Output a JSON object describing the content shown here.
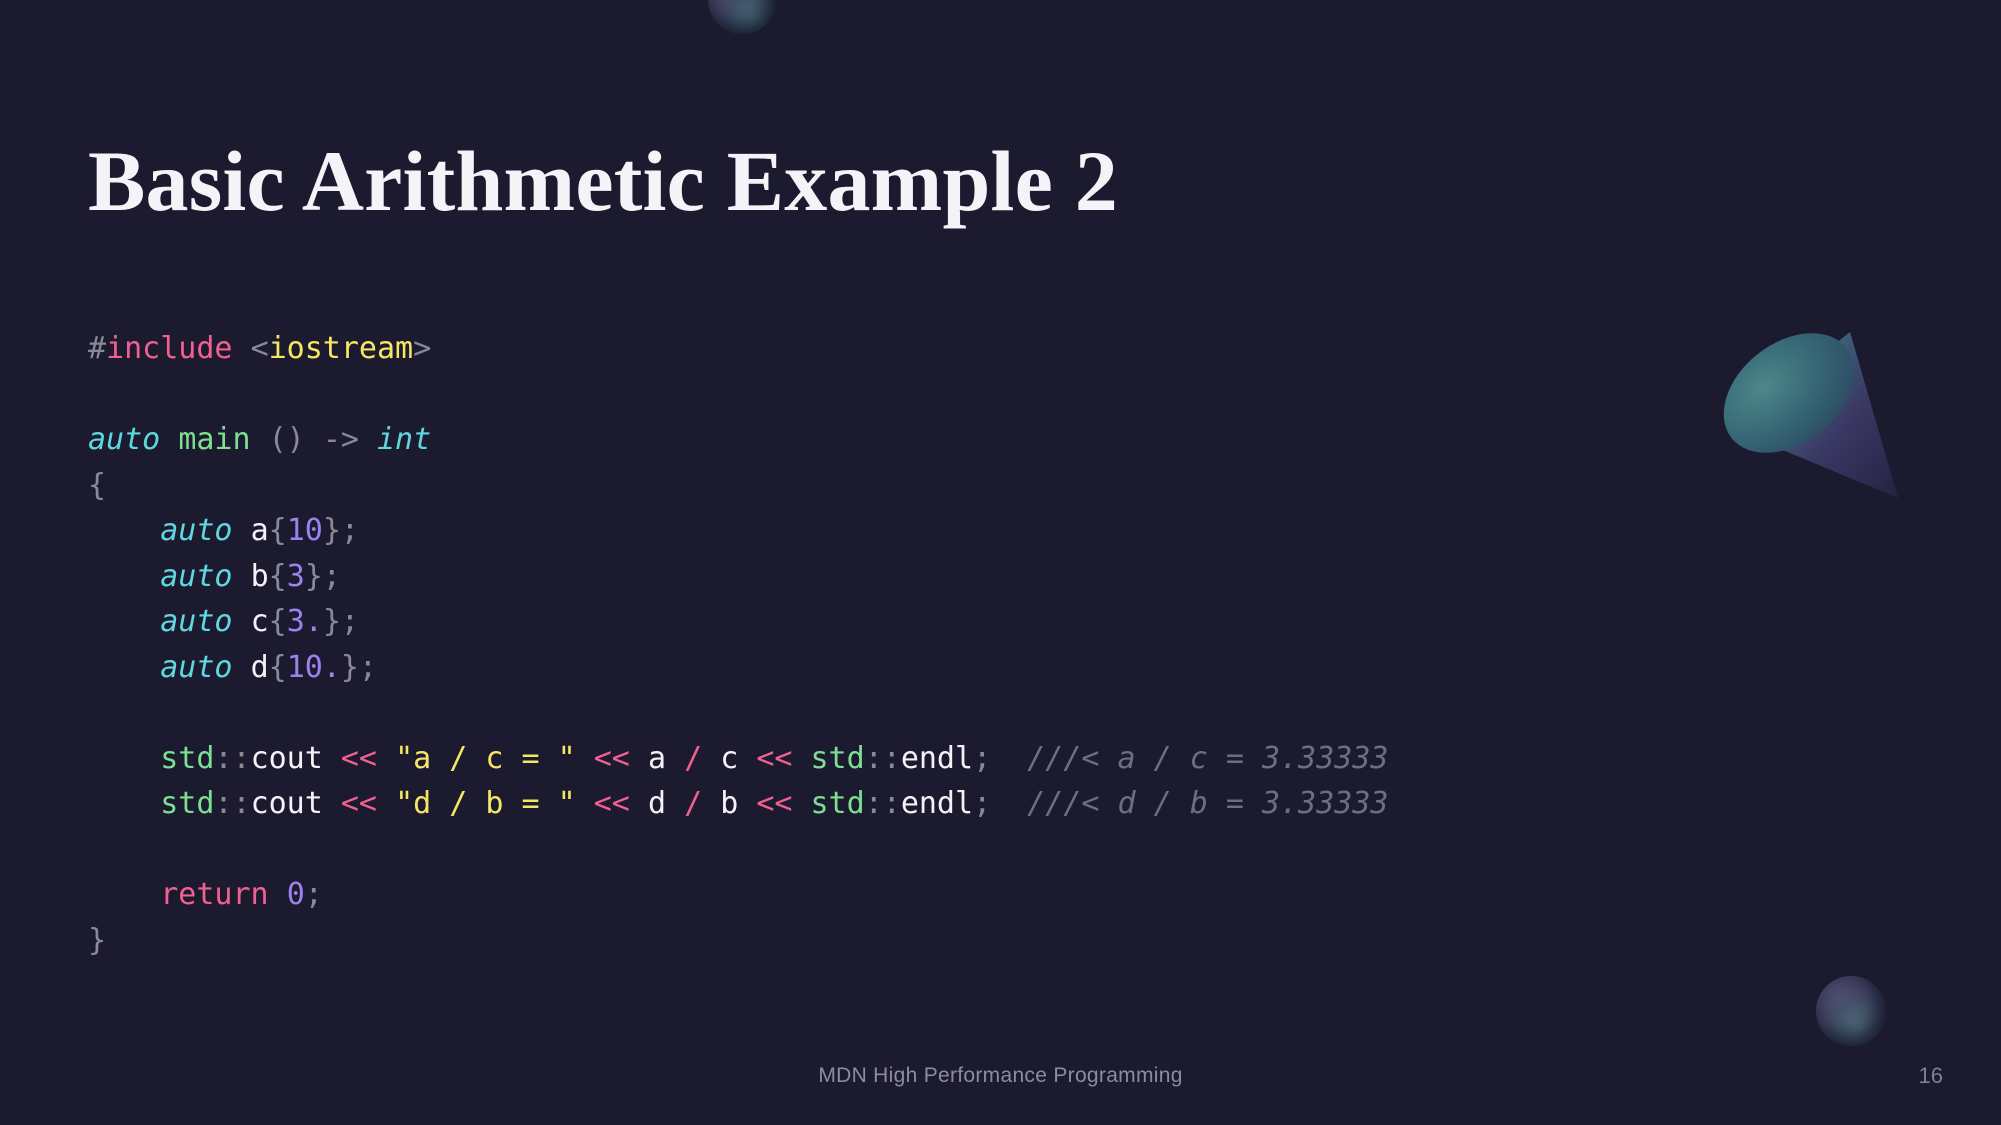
{
  "slide": {
    "title": "Basic Arithmetic Example 2",
    "background_color": "#1c1a2e",
    "footer_text": "MDN High Performance Programming",
    "page_number": "16"
  },
  "code": {
    "language": "cpp",
    "lines": [
      {
        "tokens": [
          {
            "t": "#",
            "c": "punct"
          },
          {
            "t": "include",
            "c": "pre"
          },
          {
            "t": " ",
            "c": "plain"
          },
          {
            "t": "<",
            "c": "punct"
          },
          {
            "t": "iostream",
            "c": "string"
          },
          {
            "t": ">",
            "c": "punct"
          }
        ]
      },
      {
        "tokens": []
      },
      {
        "tokens": [
          {
            "t": "auto",
            "c": "kw"
          },
          {
            "t": " ",
            "c": "plain"
          },
          {
            "t": "main",
            "c": "fn"
          },
          {
            "t": " ",
            "c": "plain"
          },
          {
            "t": "()",
            "c": "punct"
          },
          {
            "t": " ",
            "c": "plain"
          },
          {
            "t": "->",
            "c": "punct"
          },
          {
            "t": " ",
            "c": "plain"
          },
          {
            "t": "int",
            "c": "kw"
          }
        ]
      },
      {
        "tokens": [
          {
            "t": "{",
            "c": "punct"
          }
        ]
      },
      {
        "tokens": [
          {
            "t": "    ",
            "c": "plain"
          },
          {
            "t": "auto",
            "c": "kw"
          },
          {
            "t": " ",
            "c": "plain"
          },
          {
            "t": "a",
            "c": "var"
          },
          {
            "t": "{",
            "c": "punct"
          },
          {
            "t": "10",
            "c": "num"
          },
          {
            "t": "};",
            "c": "punct"
          }
        ]
      },
      {
        "tokens": [
          {
            "t": "    ",
            "c": "plain"
          },
          {
            "t": "auto",
            "c": "kw"
          },
          {
            "t": " ",
            "c": "plain"
          },
          {
            "t": "b",
            "c": "var"
          },
          {
            "t": "{",
            "c": "punct"
          },
          {
            "t": "3",
            "c": "num"
          },
          {
            "t": "};",
            "c": "punct"
          }
        ]
      },
      {
        "tokens": [
          {
            "t": "    ",
            "c": "plain"
          },
          {
            "t": "auto",
            "c": "kw"
          },
          {
            "t": " ",
            "c": "plain"
          },
          {
            "t": "c",
            "c": "var"
          },
          {
            "t": "{",
            "c": "punct"
          },
          {
            "t": "3.",
            "c": "num"
          },
          {
            "t": "};",
            "c": "punct"
          }
        ]
      },
      {
        "tokens": [
          {
            "t": "    ",
            "c": "plain"
          },
          {
            "t": "auto",
            "c": "kw"
          },
          {
            "t": " ",
            "c": "plain"
          },
          {
            "t": "d",
            "c": "var"
          },
          {
            "t": "{",
            "c": "punct"
          },
          {
            "t": "10.",
            "c": "num"
          },
          {
            "t": "};",
            "c": "punct"
          }
        ]
      },
      {
        "tokens": []
      },
      {
        "tokens": [
          {
            "t": "    ",
            "c": "plain"
          },
          {
            "t": "std",
            "c": "ns"
          },
          {
            "t": "::",
            "c": "punct"
          },
          {
            "t": "cout",
            "c": "var"
          },
          {
            "t": " ",
            "c": "plain"
          },
          {
            "t": "<<",
            "c": "op"
          },
          {
            "t": " ",
            "c": "plain"
          },
          {
            "t": "\"a / c = \"",
            "c": "string"
          },
          {
            "t": " ",
            "c": "plain"
          },
          {
            "t": "<<",
            "c": "op"
          },
          {
            "t": " ",
            "c": "plain"
          },
          {
            "t": "a",
            "c": "var"
          },
          {
            "t": " ",
            "c": "plain"
          },
          {
            "t": "/",
            "c": "op"
          },
          {
            "t": " ",
            "c": "plain"
          },
          {
            "t": "c",
            "c": "var"
          },
          {
            "t": " ",
            "c": "plain"
          },
          {
            "t": "<<",
            "c": "op"
          },
          {
            "t": " ",
            "c": "plain"
          },
          {
            "t": "std",
            "c": "ns"
          },
          {
            "t": "::",
            "c": "punct"
          },
          {
            "t": "endl",
            "c": "var"
          },
          {
            "t": ";",
            "c": "punct"
          },
          {
            "t": "  ",
            "c": "plain"
          },
          {
            "t": "///< a / c = 3.33333",
            "c": "comment"
          }
        ]
      },
      {
        "tokens": [
          {
            "t": "    ",
            "c": "plain"
          },
          {
            "t": "std",
            "c": "ns"
          },
          {
            "t": "::",
            "c": "punct"
          },
          {
            "t": "cout",
            "c": "var"
          },
          {
            "t": " ",
            "c": "plain"
          },
          {
            "t": "<<",
            "c": "op"
          },
          {
            "t": " ",
            "c": "plain"
          },
          {
            "t": "\"d / b = \"",
            "c": "string"
          },
          {
            "t": " ",
            "c": "plain"
          },
          {
            "t": "<<",
            "c": "op"
          },
          {
            "t": " ",
            "c": "plain"
          },
          {
            "t": "d",
            "c": "var"
          },
          {
            "t": " ",
            "c": "plain"
          },
          {
            "t": "/",
            "c": "op"
          },
          {
            "t": " ",
            "c": "plain"
          },
          {
            "t": "b",
            "c": "var"
          },
          {
            "t": " ",
            "c": "plain"
          },
          {
            "t": "<<",
            "c": "op"
          },
          {
            "t": " ",
            "c": "plain"
          },
          {
            "t": "std",
            "c": "ns"
          },
          {
            "t": "::",
            "c": "punct"
          },
          {
            "t": "endl",
            "c": "var"
          },
          {
            "t": ";",
            "c": "punct"
          },
          {
            "t": "  ",
            "c": "plain"
          },
          {
            "t": "///< d / b = 3.33333",
            "c": "comment"
          }
        ]
      },
      {
        "tokens": []
      },
      {
        "tokens": [
          {
            "t": "    ",
            "c": "plain"
          },
          {
            "t": "return",
            "c": "ctrl"
          },
          {
            "t": " ",
            "c": "plain"
          },
          {
            "t": "0",
            "c": "num"
          },
          {
            "t": ";",
            "c": "punct"
          }
        ]
      },
      {
        "tokens": [
          {
            "t": "}",
            "c": "punct"
          }
        ]
      }
    ]
  },
  "decorations": {
    "sphere_top": "sphere-3d",
    "sphere_bottom": "sphere-3d",
    "cone": "cone-3d",
    "accent_teal": "#4f8f8c",
    "accent_purple": "#453b6e"
  }
}
